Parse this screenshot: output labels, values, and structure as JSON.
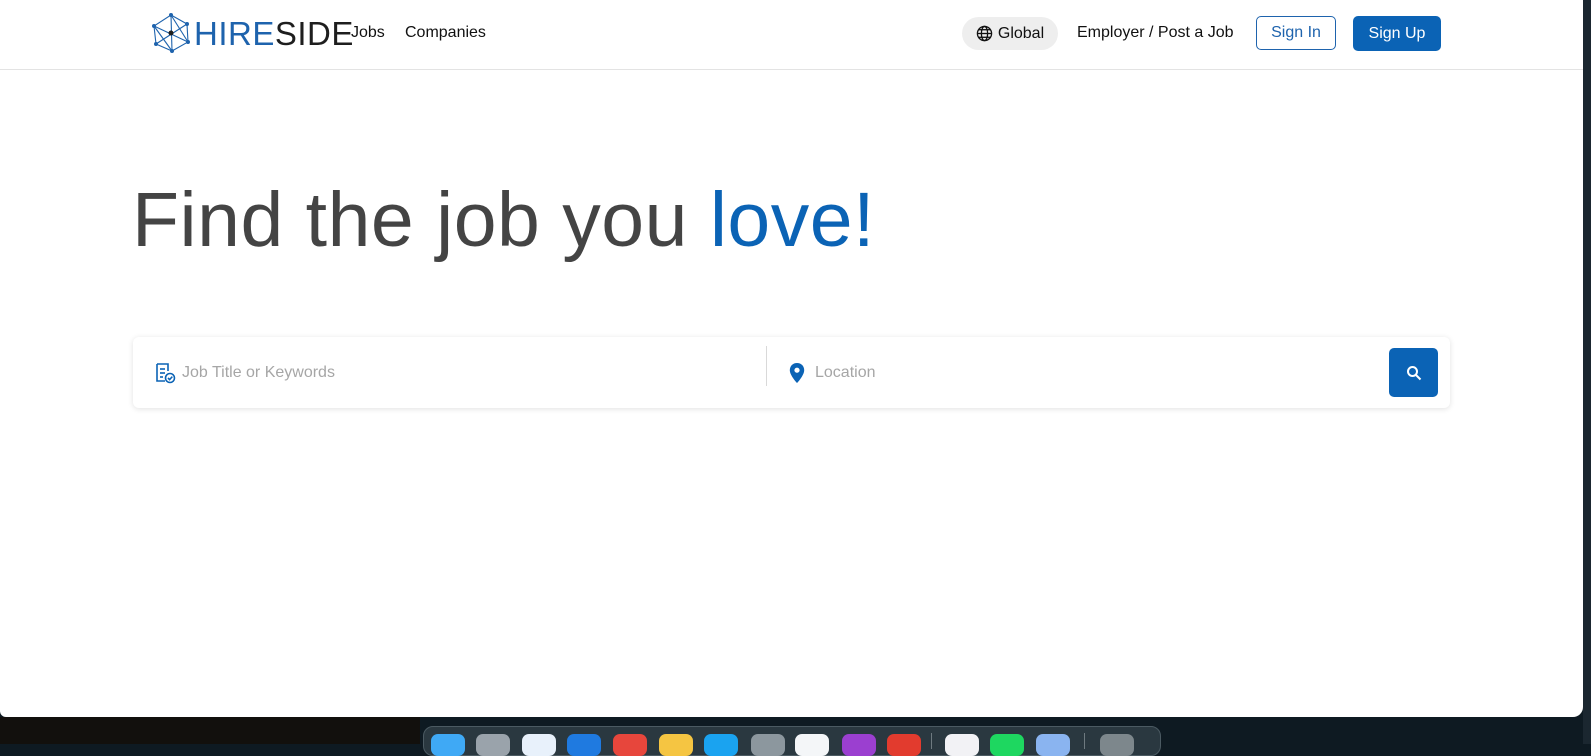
{
  "header": {
    "logo": {
      "hire": "HIRE",
      "side": "SIDE"
    },
    "nav": {
      "jobs": "Jobs",
      "companies": "Companies"
    },
    "global_label": "Global",
    "employer_link": "Employer / Post a Job",
    "sign_in": "Sign In",
    "sign_up": "Sign Up"
  },
  "hero": {
    "title_main": "Find the job you ",
    "title_accent": "love!"
  },
  "search": {
    "job_placeholder": "Job Title or Keywords",
    "location_placeholder": "Location"
  },
  "colors": {
    "brand": "#0b63b5",
    "heading": "#444444"
  },
  "dock": {
    "apps": [
      {
        "name": "finder-icon",
        "color": "#3fa9f5"
      },
      {
        "name": "launchpad-icon",
        "color": "#9aa3ab"
      },
      {
        "name": "safari-icon",
        "color": "#e8f1fb"
      },
      {
        "name": "mail-icon",
        "color": "#1f7ae0"
      },
      {
        "name": "calendar-icon",
        "color": "#e7463c"
      },
      {
        "name": "notes-icon",
        "color": "#f5c542"
      },
      {
        "name": "app-store-icon",
        "color": "#1aa3f0"
      },
      {
        "name": "system-settings-icon",
        "color": "#8c979e"
      },
      {
        "name": "files-icon",
        "color": "#f4f6f8"
      },
      {
        "name": "podcasts-icon",
        "color": "#9b3fd0"
      },
      {
        "name": "chrome-icon",
        "color": "#e23b2e"
      },
      {
        "name": "teams-icon",
        "color": "#f2f2f5"
      },
      {
        "name": "spotify-icon",
        "color": "#1ed760"
      },
      {
        "name": "preview-icon",
        "color": "#8ab4f0"
      },
      {
        "name": "trash-icon",
        "color": "#7d878c"
      }
    ]
  }
}
